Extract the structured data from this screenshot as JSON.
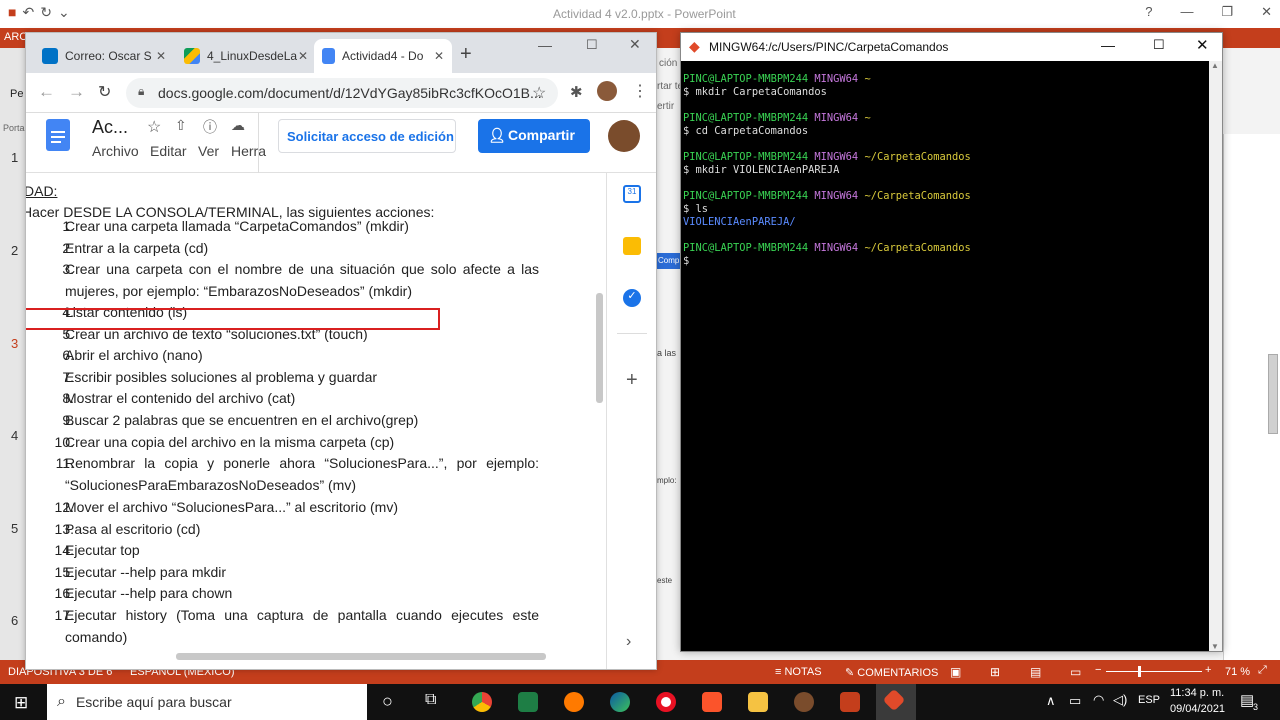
{
  "powerpoint": {
    "title": "Actividad 4 v2.0.pptx - PowerPoint",
    "ribbon_tab": "ARC",
    "slide_numbers": [
      "1",
      "2",
      "3",
      "4",
      "5",
      "6"
    ],
    "side_labels": {
      "pe": "Pe",
      "porta": "Porta"
    },
    "status": {
      "slide_info": "DIAPOSITIVA 3 DE 6",
      "language": "ESPAÑOL (MÉXICO)",
      "notes": "NOTAS",
      "comments": "COMENTARIOS",
      "zoom": "71 %"
    },
    "peek_texts": [
      "ción",
      "rtar te",
      "ertir",
      "Comp",
      "a las",
      "mplo:",
      "este"
    ]
  },
  "browser": {
    "tabs": [
      {
        "label": "Correo: Oscar S",
        "icon": "outlook-icon",
        "color": "#0072c6"
      },
      {
        "label": "4_LinuxDesdeLa",
        "icon": "drive-icon",
        "color": "#fbbc04"
      },
      {
        "label": "Actividad4 - Do",
        "icon": "docs-icon",
        "color": "#4285f4",
        "active": true
      }
    ],
    "url": "docs.google.com/document/d/12VdYGay85ibRc3cfKOcO1B...",
    "doc_title": "Ac...",
    "menus": [
      "Archivo",
      "Editar",
      "Ver",
      "Herra"
    ],
    "request_edit": "Solicitar acceso de edición",
    "share": "Compartir"
  },
  "document": {
    "heading": "DAD:",
    "intro": "Hacer DESDE LA CONSOLA/TERMINAL, las siguientes acciones:",
    "items": [
      {
        "n": "1.",
        "text": "Crear una carpeta llamada “CarpetaComandos” (mkdir)"
      },
      {
        "n": "2.",
        "text": "Entrar a la carpeta (cd)"
      },
      {
        "n": "3.",
        "text": "Crear una carpeta con el nombre de una situación que solo afecte a las mujeres, por ejemplo: “EmbarazosNoDeseados” (mkdir)"
      },
      {
        "n": "4.",
        "text": "Listar contenido (ls)"
      },
      {
        "n": "5.",
        "text": "Crear un archivo de texto “soluciones.txt” (touch)"
      },
      {
        "n": "6.",
        "text": "Abrir el archivo (nano)"
      },
      {
        "n": "7.",
        "text": "Escribir posibles soluciones al problema y guardar"
      },
      {
        "n": "8.",
        "text": "Mostrar el contenido del archivo (cat)"
      },
      {
        "n": "9.",
        "text": "Buscar 2 palabras que se encuentren en el archivo(grep)"
      },
      {
        "n": "10.",
        "text": "Crear una copia del archivo en la misma carpeta (cp)"
      },
      {
        "n": "11.",
        "text": "Renombrar la copia y ponerle ahora “SolucionesPara...”, por ejemplo: “SolucionesParaEmbarazosNoDeseados” (mv)"
      },
      {
        "n": "12.",
        "text": "Mover el archivo “SolucionesPara...” al escritorio (mv)"
      },
      {
        "n": "13.",
        "text": "Pasa al escritorio (cd)"
      },
      {
        "n": "14.",
        "text": "Ejecutar top"
      },
      {
        "n": "15.",
        "text": "Ejecutar --help para mkdir"
      },
      {
        "n": "16.",
        "text": "Ejecutar --help para chown"
      },
      {
        "n": "17.",
        "text": "Ejecutar history (Toma una captura de pantalla cuando ejecutes este comando)"
      }
    ],
    "highlighted_item": "4."
  },
  "terminal": {
    "title": "MINGW64:/c/Users/PINC/CarpetaComandos",
    "user": "PINC@LAPTOP-MMBPM244",
    "shell": "MINGW64",
    "lines": [
      {
        "path": "~",
        "cmd": "$ mkdir CarpetaComandos"
      },
      {
        "path": "~",
        "cmd": "$ cd CarpetaComandos"
      },
      {
        "path": "~/CarpetaComandos",
        "cmd": "$ mkdir VIOLENCIAenPAREJA"
      },
      {
        "path": "~/CarpetaComandos",
        "cmd": "$ ls",
        "output": "VIOLENCIAenPAREJA/"
      },
      {
        "path": "~/CarpetaComandos",
        "cmd": "$"
      }
    ]
  },
  "taskbar": {
    "search_placeholder": "Escribe aquí para buscar",
    "language": "ESP",
    "time": "11:34 p. m.",
    "date": "09/04/2021",
    "notifications": "3"
  }
}
